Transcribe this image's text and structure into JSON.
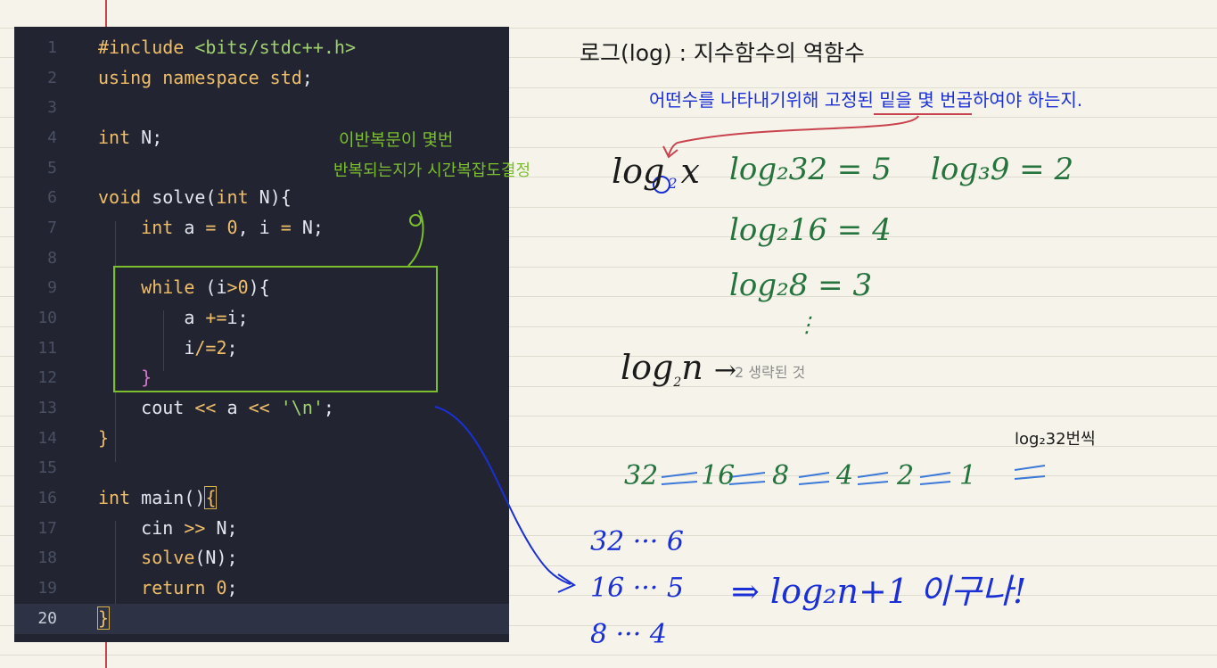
{
  "editor": {
    "lines": [
      {
        "num": "1",
        "code": "#include <bits/stdc++.h>"
      },
      {
        "num": "2",
        "code": "using namespace std;"
      },
      {
        "num": "3",
        "code": ""
      },
      {
        "num": "4",
        "code": "int N;"
      },
      {
        "num": "5",
        "code": ""
      },
      {
        "num": "6",
        "code": "void solve(int N){"
      },
      {
        "num": "7",
        "code": "    int a = 0, i = N;"
      },
      {
        "num": "8",
        "code": ""
      },
      {
        "num": "9",
        "code": "    while (i>0){"
      },
      {
        "num": "10",
        "code": "        a +=i;"
      },
      {
        "num": "11",
        "code": "        i/=2;"
      },
      {
        "num": "12",
        "code": "    }"
      },
      {
        "num": "13",
        "code": "    cout << a << '\\n';"
      },
      {
        "num": "14",
        "code": "}"
      },
      {
        "num": "15",
        "code": ""
      },
      {
        "num": "16",
        "code": "int main(){"
      },
      {
        "num": "17",
        "code": "    cin >> N;"
      },
      {
        "num": "18",
        "code": "    solve(N);"
      },
      {
        "num": "19",
        "code": "    return 0;"
      },
      {
        "num": "20",
        "code": "}"
      }
    ],
    "active_line": "20"
  },
  "notes": {
    "loop_note_line1": "이반복문이 몇번",
    "loop_note_line2": "반복되는지가 시간복잡도결정",
    "title": "로그(log) : 지수함수의 역함수",
    "definition": "어떤수를 나타내기위해 고정된 밑을 몇 번곱하여야 하는지.",
    "base_highlight": "2",
    "log_x": "log",
    "log_x_var": "x",
    "eq1": "log₂32 = 5",
    "eq2": "log₂16 = 4",
    "eq3": "log₂8 = 3",
    "eq4": "log₃9 = 2",
    "dots": "⋮",
    "logn": "log",
    "logn_base": "2",
    "logn_var": "n",
    "logn_arrow": "→",
    "omitted": "2 생략된 것",
    "times_label": "log₂32번씩",
    "sequence": [
      "32",
      "16",
      "8",
      "4",
      "2",
      "1"
    ],
    "count1": "32 ··· 6",
    "count2": "16 ··· 5",
    "count3": "8 ··· 4",
    "result": "⇒ log₂n+1 이구나!"
  },
  "colors": {
    "editor_bg": "#222531",
    "keyword": "#f0be69",
    "string": "#9fd06f",
    "bracket": "#d677c8",
    "note_green": "#25733d",
    "note_blue": "#1a2fd6",
    "note_lime": "#7cbf2e",
    "note_red": "#c9434e"
  }
}
